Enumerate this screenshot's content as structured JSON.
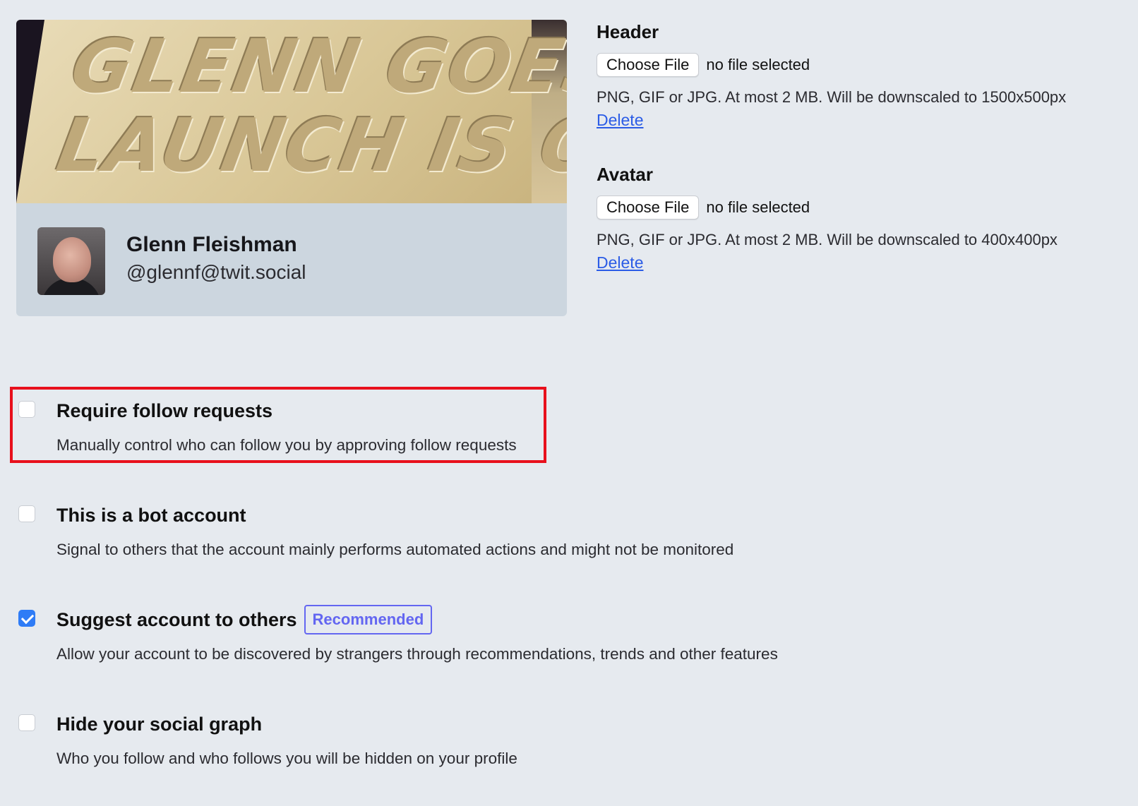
{
  "profile": {
    "header_banner_lines": [
      "GLENN GOES!",
      "LAUNCH IS OK"
    ],
    "display_name": "Glenn Fleishman",
    "username": "@glennf@twit.social"
  },
  "uploads": {
    "header": {
      "label": "Header",
      "button": "Choose File",
      "status": "no file selected",
      "hint": "PNG, GIF or JPG. At most 2 MB. Will be downscaled to 1500x500px",
      "delete": "Delete"
    },
    "avatar": {
      "label": "Avatar",
      "button": "Choose File",
      "status": "no file selected",
      "hint": "PNG, GIF or JPG. At most 2 MB. Will be downscaled to 400x400px",
      "delete": "Delete"
    }
  },
  "settings": [
    {
      "title": "Require follow requests",
      "description": "Manually control who can follow you by approving follow requests",
      "checked": false,
      "highlighted": true
    },
    {
      "title": "This is a bot account",
      "description": "Signal to others that the account mainly performs automated actions and might not be monitored",
      "checked": false
    },
    {
      "title": "Suggest account to others",
      "badge": "Recommended",
      "description": "Allow your account to be discovered by strangers through recommendations, trends and other features",
      "checked": true
    },
    {
      "title": "Hide your social graph",
      "description": "Who you follow and who follows you will be hidden on your profile",
      "checked": false
    }
  ],
  "colors": {
    "page_background": "#e6eaef",
    "link": "#2b5ce6",
    "checkbox_checked": "#2f7cf6",
    "badge": "#6366f1",
    "highlight_border": "#e8101c"
  },
  "icons": {
    "avatar": "user-photo",
    "header": "banner-photo"
  }
}
